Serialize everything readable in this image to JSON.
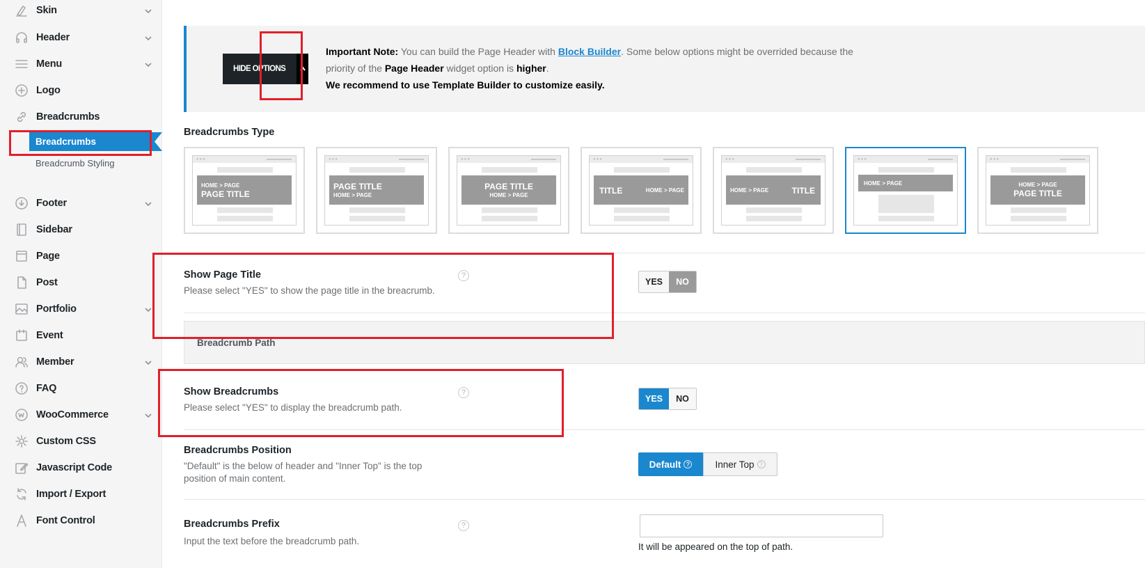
{
  "sidebar": {
    "items": [
      {
        "label": "Skin",
        "icon": "brush-icon",
        "chevron": true
      },
      {
        "label": "Header",
        "icon": "headphones-icon",
        "chevron": true
      },
      {
        "label": "Menu",
        "icon": "menu-icon",
        "chevron": true
      },
      {
        "label": "Logo",
        "icon": "plus-circle-icon",
        "chevron": false
      },
      {
        "label": "Breadcrumbs",
        "icon": "link-icon",
        "chevron": false
      },
      {
        "label": "Footer",
        "icon": "arrow-down-circle-icon",
        "chevron": true
      },
      {
        "label": "Sidebar",
        "icon": "sidebar-icon",
        "chevron": false
      },
      {
        "label": "Page",
        "icon": "page-icon",
        "chevron": false
      },
      {
        "label": "Post",
        "icon": "post-icon",
        "chevron": false
      },
      {
        "label": "Portfolio",
        "icon": "image-icon",
        "chevron": true
      },
      {
        "label": "Event",
        "icon": "calendar-icon",
        "chevron": false
      },
      {
        "label": "Member",
        "icon": "users-icon",
        "chevron": true
      },
      {
        "label": "FAQ",
        "icon": "question-circle-icon",
        "chevron": false
      },
      {
        "label": "WooCommerce",
        "icon": "woocommerce-icon",
        "chevron": true
      },
      {
        "label": "Custom CSS",
        "icon": "gear-icon",
        "chevron": false
      },
      {
        "label": "Javascript Code",
        "icon": "edit-icon",
        "chevron": false
      },
      {
        "label": "Import / Export",
        "icon": "refresh-icon",
        "chevron": false
      },
      {
        "label": "Font Control",
        "icon": "font-icon",
        "chevron": false
      }
    ],
    "subitems": {
      "active": "Breadcrumbs",
      "other": "Breadcrumb Styling"
    }
  },
  "notice": {
    "hide_options": "HIDE OPTIONS",
    "important_label": "Important Note:",
    "text1": " You can build the Page Header with ",
    "link": "Block Builder",
    "text2": ". Some below options might be overrided because the priority of the ",
    "widget": "Page Header",
    "text3": " widget option is ",
    "higher": "higher",
    "text4": ".",
    "recommend": "We recommend to use Template Builder to customize easily."
  },
  "breadcrumbs_type": {
    "title": "Breadcrumbs Type",
    "selected_index": 5,
    "cards": [
      {
        "line1": "HOME > PAGE",
        "line2": "PAGE TITLE"
      },
      {
        "line1": "PAGE TITLE",
        "line2": "HOME > PAGE"
      },
      {
        "line1": "PAGE TITLE",
        "line2": "HOME > PAGE"
      },
      {
        "line1": "TITLE",
        "line2": "HOME > PAGE"
      },
      {
        "line1": "HOME > PAGE",
        "line2": "TITLE"
      },
      {
        "line1": "HOME > PAGE",
        "line2": ""
      },
      {
        "line1": "HOME > PAGE",
        "line2": "PAGE TITLE"
      }
    ]
  },
  "show_page_title": {
    "title": "Show Page Title",
    "desc": "Please select \"YES\" to show the page title in the breacrumb.",
    "yes": "YES",
    "no": "NO",
    "value": "NO"
  },
  "breadcrumb_path": {
    "title": "Breadcrumb Path"
  },
  "show_breadcrumbs": {
    "title": "Show Breadcrumbs",
    "desc": "Please select \"YES\" to display the breadcrumb path.",
    "yes": "YES",
    "no": "NO",
    "value": "YES"
  },
  "breadcrumbs_position": {
    "title": "Breadcrumbs Position",
    "desc": "\"Default\" is the below of header and \"Inner Top\" is the top position of main content.",
    "default": "Default",
    "inner_top": "Inner Top",
    "value": "Default"
  },
  "breadcrumbs_prefix": {
    "title": "Breadcrumbs Prefix",
    "desc": "Input the text before the breadcrumb path.",
    "value": "",
    "note": "It will be appeared on the top of path."
  },
  "help_glyph": "?",
  "colors": {
    "accent": "#1a87cf",
    "highlight_box": "#e0202a",
    "dark_button": "#1d2327"
  }
}
